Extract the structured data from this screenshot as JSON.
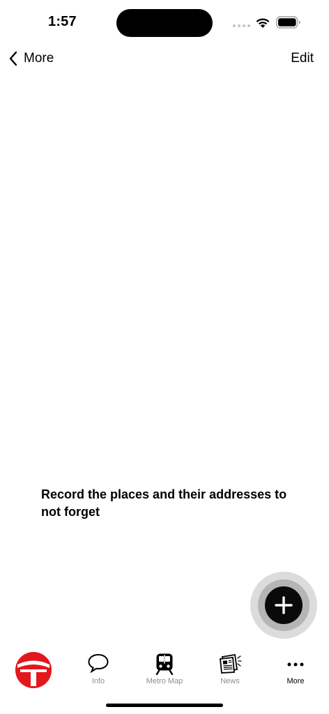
{
  "status_bar": {
    "time": "1:57",
    "icons": [
      "cellular-signal-icon",
      "wifi-icon",
      "battery-icon"
    ]
  },
  "nav": {
    "back_label": "More",
    "edit_label": "Edit"
  },
  "main": {
    "empty_message": "Record the places and their addresses to not forget"
  },
  "fab": {
    "icon": "plus-icon"
  },
  "tab_bar": {
    "logo_icon": "metro-logo-icon",
    "tabs": [
      {
        "label": "Info",
        "icon": "speech-bubble-icon"
      },
      {
        "label": "Metro Map",
        "icon": "train-icon"
      },
      {
        "label": "News",
        "icon": "newspaper-icon"
      },
      {
        "label": "More",
        "icon": "ellipsis-icon",
        "active": true
      }
    ]
  },
  "colors": {
    "logo_red": "#e3171d",
    "tab_inactive": "#8e8e93",
    "tab_active": "#000000"
  }
}
